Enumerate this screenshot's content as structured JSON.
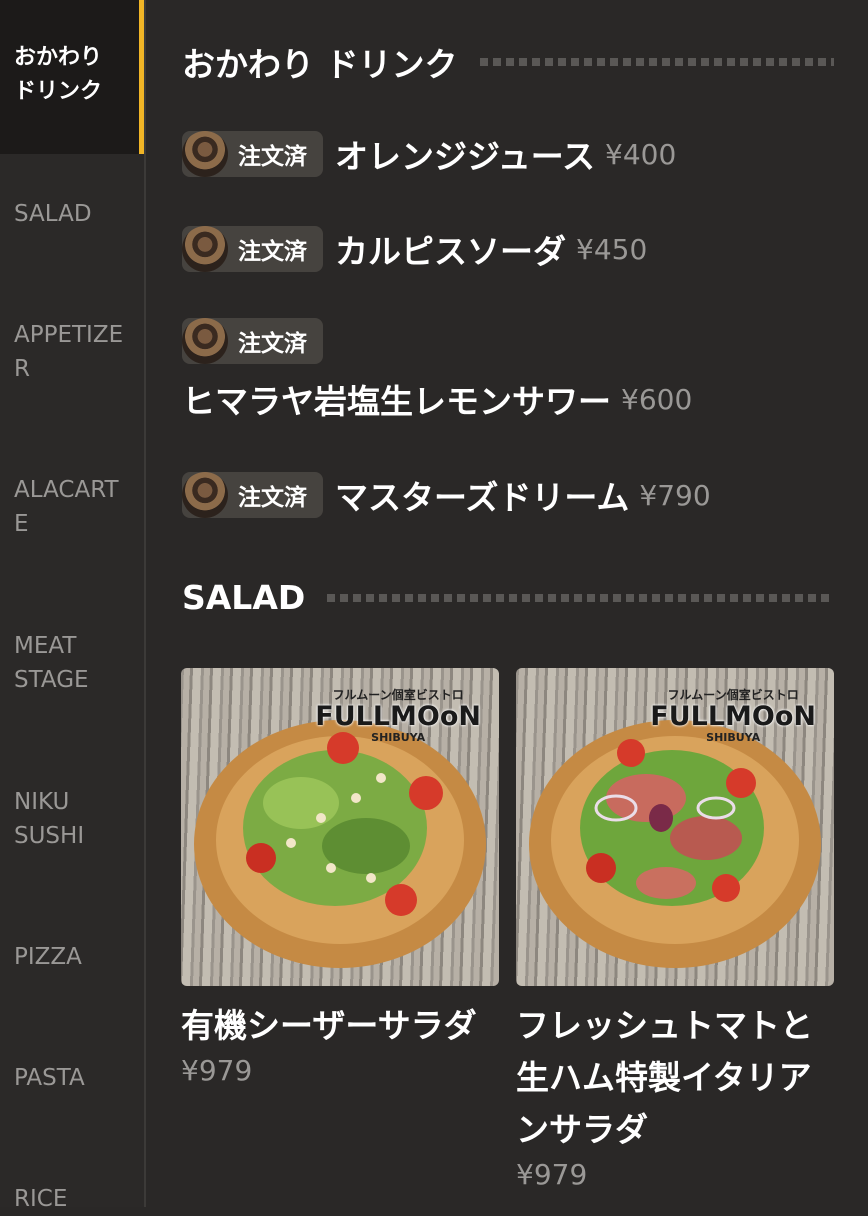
{
  "sidebar": {
    "items": [
      {
        "label": "おかわり\nドリンク"
      },
      {
        "label": "SALAD"
      },
      {
        "label": "APPETIZE\nR"
      },
      {
        "label": "ALACART\nE"
      },
      {
        "label": "MEAT\nSTAGE"
      },
      {
        "label": "NIKU\nSUSHI"
      },
      {
        "label": "PIZZA"
      },
      {
        "label": "PASTA"
      },
      {
        "label": "RICE"
      }
    ]
  },
  "sections": {
    "drinks": {
      "title": "おかわり ドリンク",
      "items": [
        {
          "badge": "注文済",
          "name": "オレンジジュース",
          "price": "¥400"
        },
        {
          "badge": "注文済",
          "name": "カルピスソーダ",
          "price": "¥450"
        },
        {
          "badge": "注文済",
          "name": "ヒマラヤ岩塩生レモンサワー",
          "price": "¥600"
        },
        {
          "badge": "注文済",
          "name": "マスターズドリーム",
          "price": "¥790"
        }
      ]
    },
    "salad": {
      "title": "SALAD",
      "items": [
        {
          "logo_top": "フルムーン個室ビストロ",
          "logo_main": "FULLMOoN",
          "logo_sub": "SHIBUYA",
          "name": "有機シーザーサラダ",
          "price": "¥979"
        },
        {
          "logo_top": "フルムーン個室ビストロ",
          "logo_main": "FULLMOoN",
          "logo_sub": "SHIBUYA",
          "name": "フレッシュトマトと\n生ハム特製イタリア\nンサラダ",
          "price": "¥979"
        }
      ]
    }
  },
  "colors": {
    "accent": "#f1b526",
    "background": "#2a2827",
    "badge": "#46433f"
  }
}
